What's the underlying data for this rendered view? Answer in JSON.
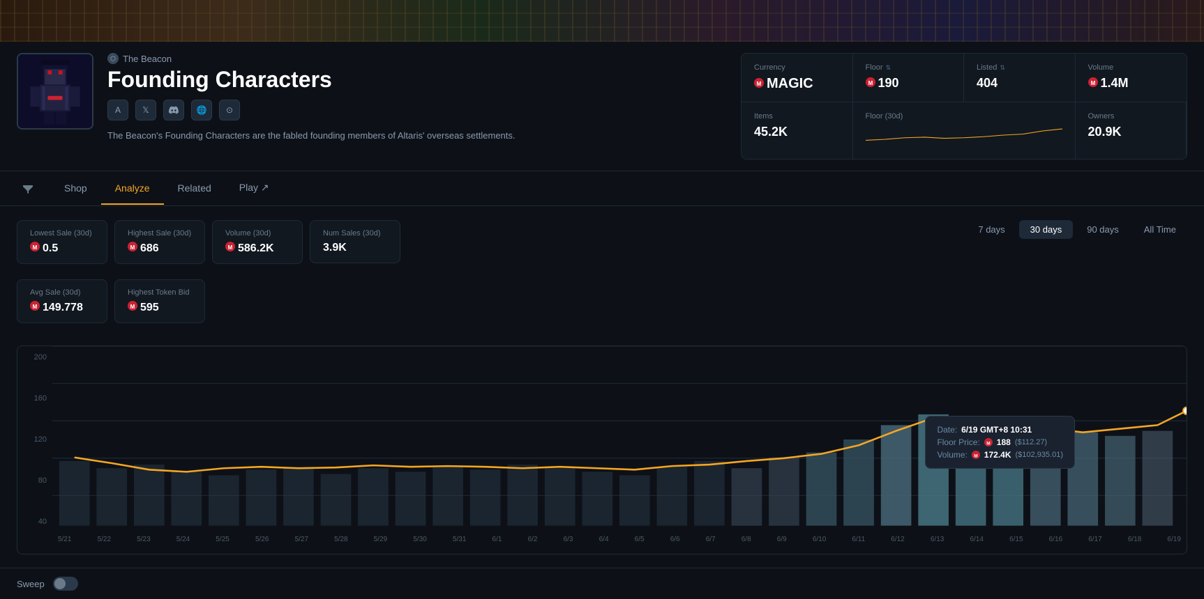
{
  "banner": {
    "height": 60
  },
  "profile": {
    "brand": "The Beacon",
    "title": "Founding Characters",
    "description": "The Beacon's Founding Characters are the fabled founding members of Altaris' overseas settlements.",
    "social_links": [
      "A",
      "🐦",
      "💬",
      "🌐",
      "⭕"
    ]
  },
  "stats": {
    "currency_label": "Currency",
    "currency_value": "MAGIC",
    "floor_label": "Floor",
    "floor_value": "190",
    "listed_label": "Listed",
    "listed_value": "404",
    "volume_label": "Volume",
    "volume_value": "1.4M",
    "items_label": "Items",
    "items_value": "45.2K",
    "floor30_label": "Floor (30d)",
    "owners_label": "Owners",
    "owners_value": "20.9K"
  },
  "nav": {
    "tabs": [
      "Shop",
      "Analyze",
      "Related",
      "Play ↗"
    ],
    "active": "Analyze"
  },
  "analyze": {
    "lowest_sale_label": "Lowest Sale (30d)",
    "lowest_sale_value": "0.5",
    "highest_sale_label": "Highest Sale (30d)",
    "highest_sale_value": "686",
    "volume_label": "Volume (30d)",
    "volume_value": "586.2K",
    "num_sales_label": "Num Sales (30d)",
    "num_sales_value": "3.9K",
    "avg_sale_label": "Avg Sale (30d)",
    "avg_sale_value": "149.778",
    "highest_bid_label": "Highest Token Bid",
    "highest_bid_value": "595",
    "time_options": [
      "7 days",
      "30 days",
      "90 days",
      "All Time"
    ],
    "active_time": "30 days"
  },
  "chart": {
    "y_labels": [
      "200",
      "160",
      "120",
      "80",
      "40"
    ],
    "x_labels": [
      "5/21",
      "5/22",
      "5/23",
      "5/24",
      "5/25",
      "5/26",
      "5/27",
      "5/28",
      "5/29",
      "5/30",
      "5/31",
      "6/1",
      "6/2",
      "6/3",
      "6/4",
      "6/5",
      "6/6",
      "6/7",
      "6/8",
      "6/9",
      "6/10",
      "6/11",
      "6/12",
      "6/13",
      "6/14",
      "6/15",
      "6/16",
      "6/17",
      "6/18",
      "6/19"
    ],
    "tooltip": {
      "date_label": "Date:",
      "date_value": "6/19 GMT+8 10:31",
      "price_label": "Floor Price:",
      "price_value": "188",
      "price_usd": "($112.27)",
      "volume_label": "Volume:",
      "volume_value": "172.4K",
      "volume_usd": "($102,935.01)"
    }
  },
  "sweep": {
    "label": "Sweep"
  }
}
